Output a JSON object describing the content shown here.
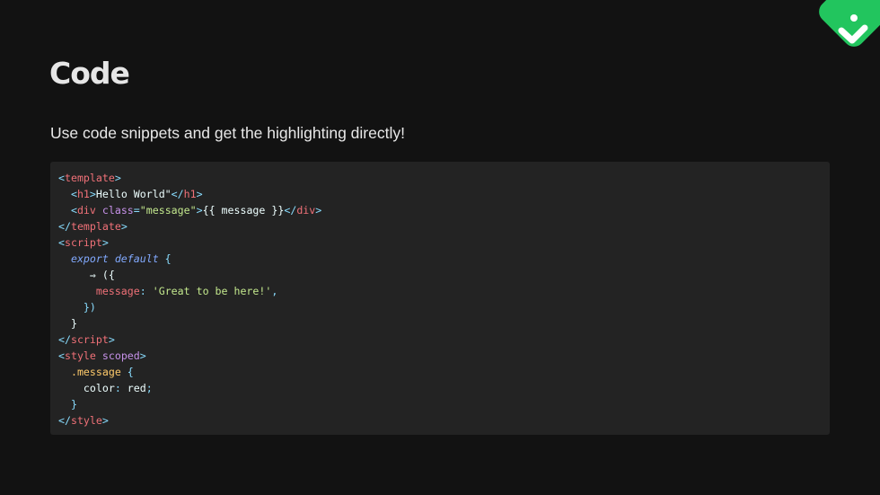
{
  "slide": {
    "title": "Code",
    "subtitle": "Use code snippets and get the highlighting directly!"
  },
  "logo": {
    "icon": "check-logo-icon",
    "color": "#22c55e"
  },
  "code": {
    "language": "vue",
    "lines": [
      [
        {
          "t": "<",
          "c": "punct"
        },
        {
          "t": "template",
          "c": "tag"
        },
        {
          "t": ">",
          "c": "punct"
        }
      ],
      [
        {
          "t": "  ",
          "c": "text"
        },
        {
          "t": "<",
          "c": "punct"
        },
        {
          "t": "h1",
          "c": "tag"
        },
        {
          "t": ">",
          "c": "punct"
        },
        {
          "t": "Hello World\"",
          "c": "text"
        },
        {
          "t": "</",
          "c": "punct"
        },
        {
          "t": "h1",
          "c": "tag"
        },
        {
          "t": ">",
          "c": "punct"
        }
      ],
      [
        {
          "t": "  ",
          "c": "text"
        },
        {
          "t": "<",
          "c": "punct"
        },
        {
          "t": "div",
          "c": "tag"
        },
        {
          "t": " ",
          "c": "text"
        },
        {
          "t": "class",
          "c": "attr"
        },
        {
          "t": "=",
          "c": "punct"
        },
        {
          "t": "\"message\"",
          "c": "str"
        },
        {
          "t": ">",
          "c": "punct"
        },
        {
          "t": "{{ message }}",
          "c": "text"
        },
        {
          "t": "</",
          "c": "punct"
        },
        {
          "t": "div",
          "c": "tag"
        },
        {
          "t": ">",
          "c": "punct"
        }
      ],
      [
        {
          "t": "</",
          "c": "punct"
        },
        {
          "t": "template",
          "c": "tag"
        },
        {
          "t": ">",
          "c": "punct"
        }
      ],
      [
        {
          "t": "<",
          "c": "punct"
        },
        {
          "t": "script",
          "c": "tag"
        },
        {
          "t": ">",
          "c": "punct"
        }
      ],
      [
        {
          "t": "  ",
          "c": "text"
        },
        {
          "t": "export default",
          "c": "kw"
        },
        {
          "t": " {",
          "c": "punct"
        }
      ],
      [
        {
          "t": "     ⇒ ({",
          "c": "text"
        }
      ],
      [
        {
          "t": "      ",
          "c": "text"
        },
        {
          "t": "message",
          "c": "prop"
        },
        {
          "t": ": ",
          "c": "punct"
        },
        {
          "t": "'Great to be here!'",
          "c": "str"
        },
        {
          "t": ",",
          "c": "punct"
        }
      ],
      [
        {
          "t": "    ",
          "c": "text"
        },
        {
          "t": "})",
          "c": "punct"
        }
      ],
      [
        {
          "t": "  }",
          "c": "text"
        }
      ],
      [
        {
          "t": "</",
          "c": "punct"
        },
        {
          "t": "script",
          "c": "tag"
        },
        {
          "t": ">",
          "c": "punct"
        }
      ],
      [
        {
          "t": "<",
          "c": "punct"
        },
        {
          "t": "style",
          "c": "tag"
        },
        {
          "t": " ",
          "c": "text"
        },
        {
          "t": "scoped",
          "c": "attr"
        },
        {
          "t": ">",
          "c": "punct"
        }
      ],
      [
        {
          "t": "  ",
          "c": "text"
        },
        {
          "t": ".message",
          "c": "sel"
        },
        {
          "t": " {",
          "c": "punct"
        }
      ],
      [
        {
          "t": "    ",
          "c": "text"
        },
        {
          "t": "color",
          "c": "val"
        },
        {
          "t": ": ",
          "c": "punct"
        },
        {
          "t": "red",
          "c": "val"
        },
        {
          "t": ";",
          "c": "punct"
        }
      ],
      [
        {
          "t": "  ",
          "c": "text"
        },
        {
          "t": "}",
          "c": "punct"
        }
      ],
      [
        {
          "t": "</",
          "c": "punct"
        },
        {
          "t": "style",
          "c": "tag"
        },
        {
          "t": ">",
          "c": "punct"
        }
      ]
    ]
  }
}
